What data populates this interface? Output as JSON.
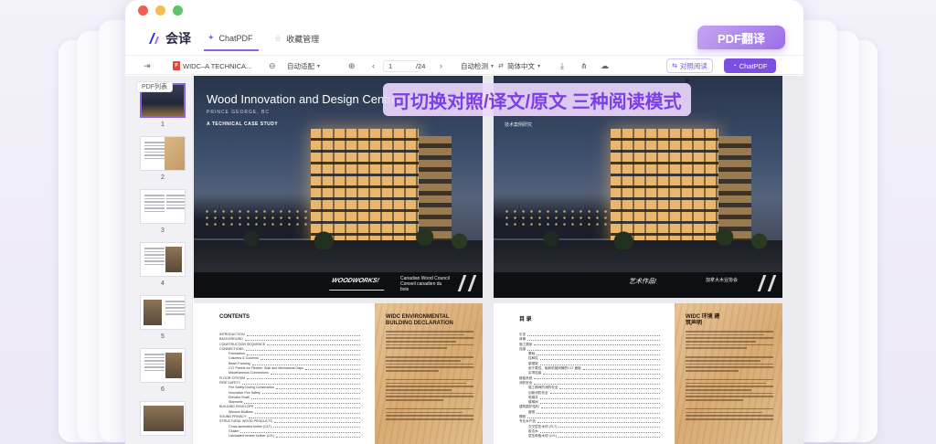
{
  "window": {
    "traffic_lights": [
      "close",
      "minimize",
      "zoom"
    ]
  },
  "app": {
    "logo_text": "会译",
    "tabs": [
      {
        "label": "ChatPDF",
        "icon": "chat-icon",
        "active": true
      },
      {
        "label": "收藏管理",
        "icon": "star-icon",
        "active": false
      }
    ],
    "badge": "PDF翻译"
  },
  "toolbar": {
    "file_name": "WIDC–A TECHNICA...",
    "zoom_mode": "自动适配",
    "current_page": "1",
    "total_pages": "/24",
    "detect_lang": "自动检测",
    "target_lang": "简体中文",
    "compare_button": "对照阅读",
    "chatpdf_button": "ChatPDF"
  },
  "sidebar": {
    "header": "PDF列表",
    "thumbnails": [
      {
        "num": "1",
        "active": true
      },
      {
        "num": "2",
        "active": false
      },
      {
        "num": "3",
        "active": false
      },
      {
        "num": "4",
        "active": false
      },
      {
        "num": "5",
        "active": false
      },
      {
        "num": "6",
        "active": false
      },
      {
        "num": "",
        "active": false
      }
    ]
  },
  "banner": "可切换对照/译文/原文 三种阅读模式",
  "original_page": {
    "title": "Wood Innovation and Design Centre",
    "subtitle": "PRINCE GEORGE, BC",
    "case_study": "A TECHNICAL CASE STUDY",
    "logo_wood": "WOODWORKS!",
    "logo_cwc": "Canadian Wood Council  Conseil canadien du bois",
    "contents_title": "CONTENTS",
    "contents_rows": [
      "INTRODUCTION",
      "BACKGROUND",
      "CONSTRUCTION SEQUENCE",
      "CONNECTIONS",
      "Foundation",
      "Columns & Columns",
      "Beam Framing",
      "CLT Panels for Flexible, Slab and Mechanical Gaps",
      "Miscellaneous Connections",
      "FLOOR SYSTEM",
      "FIRE SAFETY",
      "Fire Safety During Construction",
      "Innovative Fire Safety",
      "Elevator Shaft",
      "Stairwells",
      "BUILDING ENVELOPE",
      "Window Mullions",
      "SOUND PRIVACY",
      "STRUCTURAL WOOD PRODUCTS",
      "Cross-laminated timber (CLT)",
      "Glulam",
      "Laminated veneer lumber (LVL)"
    ],
    "wood_heading": "WIDC ENVIRONMENTAL BUILDING DECLARATION"
  },
  "translated_page": {
    "case_study": "技术案例研究",
    "logo_wood": "艺术作品!",
    "logo_cwc": "加拿大木业协会",
    "contents_title": "目 录",
    "contents_rows": [
      "引言",
      "背景",
      "施工顺序",
      "连接",
      "基础",
      "柱和柱",
      "梁框架",
      "用于柔性、板和机械间隙的CLT 面板",
      "杂项连接",
      "楼板系统",
      "消防安全",
      "施工期间的消防安全",
      "创新消防安全",
      "电梯井",
      "楼梯间",
      "建筑围护结构",
      "窗框",
      "隔音",
      "专业木产品",
      "交叉层压木材 (CLT)",
      "胶合木",
      "层压单板木材 (LVL)"
    ],
    "wood_heading": "WIDC 环境 建筑声明"
  }
}
